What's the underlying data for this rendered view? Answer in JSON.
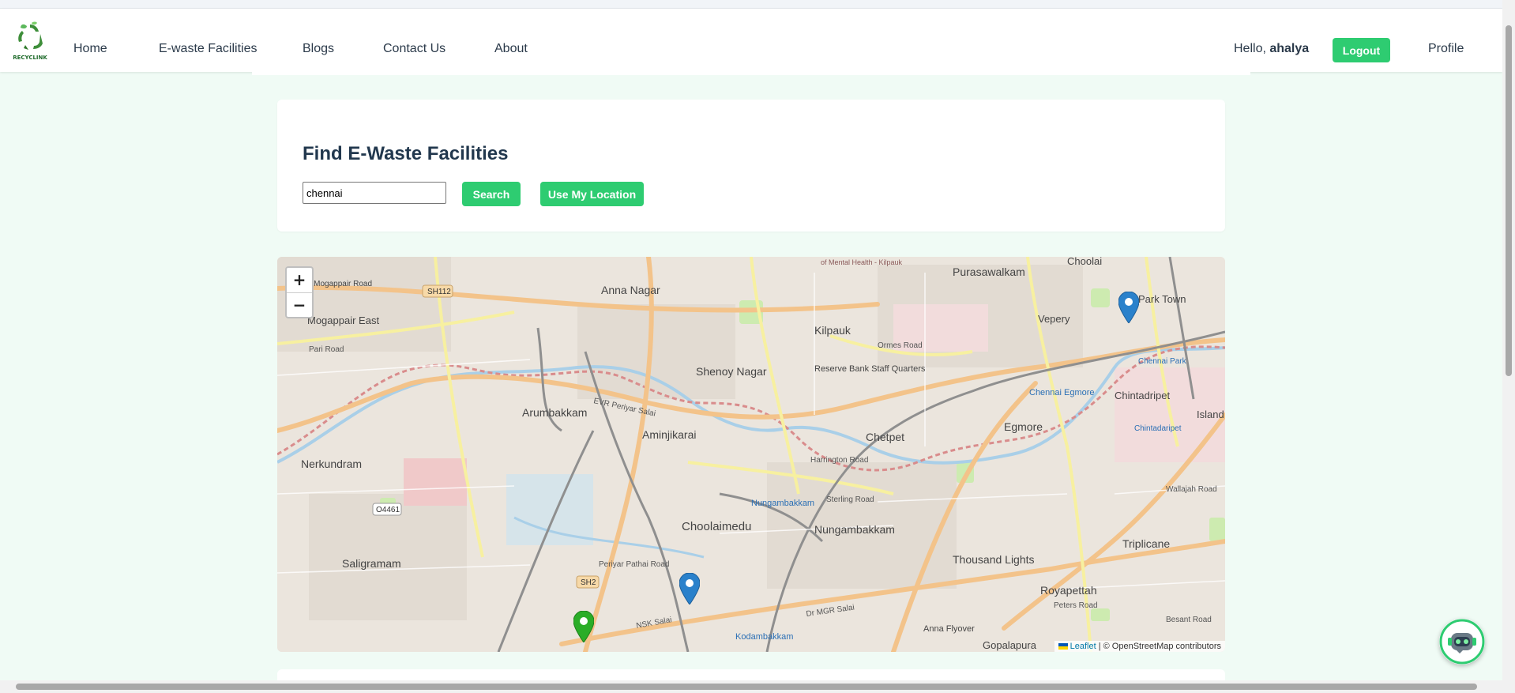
{
  "brand": {
    "logo_text": "RECYCLINK"
  },
  "nav": {
    "home": "Home",
    "facilities": "E-waste Facilities",
    "blogs": "Blogs",
    "contact": "Contact Us",
    "about": "About"
  },
  "user": {
    "greeting_prefix": "Hello,",
    "name": "ahalya",
    "logout_label": "Logout",
    "profile_label": "Profile"
  },
  "search": {
    "title": "Find E-Waste Facilities",
    "input_value": "chennai",
    "search_label": "Search",
    "location_label": "Use My Location"
  },
  "map": {
    "zoom_in": "+",
    "zoom_out": "−",
    "attribution_link": "Leaflet",
    "attribution_text": "| © OpenStreetMap contributors",
    "labels": {
      "anna_nagar": "Anna Nagar",
      "purasawalkam": "Purasawalkam",
      "choolai": "Choolai",
      "vepery": "Vepery",
      "park_town": "Park Town",
      "mogappair_east": "Mogappair East",
      "kilpauk": "Kilpauk",
      "shenoy_nagar": "Shenoy Nagar",
      "rbi_staff_quarters": "Reserve Bank Staff Quarters",
      "chennai_egmore": "Chennai Egmore",
      "chintadripet": "Chintadripet",
      "island_grounds": "Island Gro",
      "arumbakkam": "Arumbakkam",
      "aminjikarai": "Aminjikarai",
      "chetpet": "Chetpet",
      "egmore": "Egmore",
      "nerkundram": "Nerkundram",
      "nungambakkam_station": "Nungambakkam",
      "nungambakkam": "Nungambakkam",
      "choolaimedu": "Choolaimedu",
      "saligramam": "Saligramam",
      "thousand_lights": "Thousand Lights",
      "triplicane": "Triplicane",
      "royapettah": "Royapettah",
      "kodambakkam": "Kodambakkam",
      "gopalapuram": "Gopalapura",
      "anna_flyover": "Anna Flyover",
      "sh112": "SH112",
      "sh2": "SH2",
      "o4461": "O4461",
      "evr_periyar_salai": "EVR Periyar Salai",
      "pari_road": "Pari Road",
      "ormes_road": "Ormes Road",
      "harrington_road": "Harrington Road",
      "sterling_road": "Sterling Road",
      "periyar_pathai": "Periyar Pathai Road",
      "nsk_salai": "NSK Salai",
      "dr_mgr_salai": "Dr MGR Salai",
      "wallajah_road": "Wallajah Road",
      "peters_road": "Peters Road",
      "besant_road": "Besant Road",
      "chennai_park": "Chennai Park",
      "chintadaripet_station": "Chintadaripet",
      "mogappair_road": "galam - Mogappair Road",
      "kilpauk_health": "of Mental Health - Kilpauk"
    }
  },
  "colors": {
    "accent": "#2ecc71",
    "page_bg": "#f0fbf5",
    "marker_blue": "#2a81cb",
    "marker_green": "#2aad27"
  },
  "icons": {
    "logo": "recycle-leaf-icon",
    "facility_marker": "map-pin-icon",
    "chatbot": "robot-chat-icon"
  }
}
